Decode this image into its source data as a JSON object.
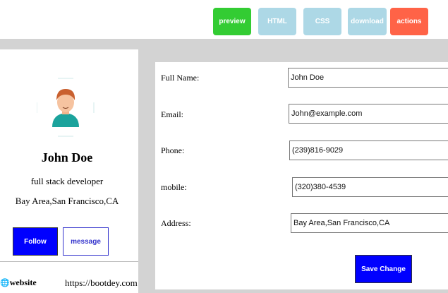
{
  "toolbar": {
    "buttons": [
      {
        "label": "preview",
        "color": "#33cc33"
      },
      {
        "label": "HTML",
        "color": "#add8e6"
      },
      {
        "label": "CSS",
        "color": "#add8e6"
      },
      {
        "label": "download",
        "color": "#add8e6"
      },
      {
        "label": "actions",
        "color": "#ff6347"
      }
    ]
  },
  "profile": {
    "name": "John Doe",
    "role": "full stack developer",
    "location": "Bay Area,San Francisco,CA",
    "follow_label": "Follow",
    "message_label": "message",
    "website_label": "website",
    "website_url": "https://bootdey.com"
  },
  "form": {
    "fields": [
      {
        "label": "Full Name:",
        "value": "John Doe"
      },
      {
        "label": "Email:",
        "value": "John@example.com"
      },
      {
        "label": "Phone:",
        "value": "(239)816-9029"
      },
      {
        "label": "mobile:",
        "value": "(320)380-4539"
      },
      {
        "label": "Address:",
        "value": "Bay Area,San Francisco,CA"
      }
    ],
    "save_label": "Save Change"
  },
  "colors": {
    "primary": "#0000ff",
    "background": "#d3d3d3"
  }
}
